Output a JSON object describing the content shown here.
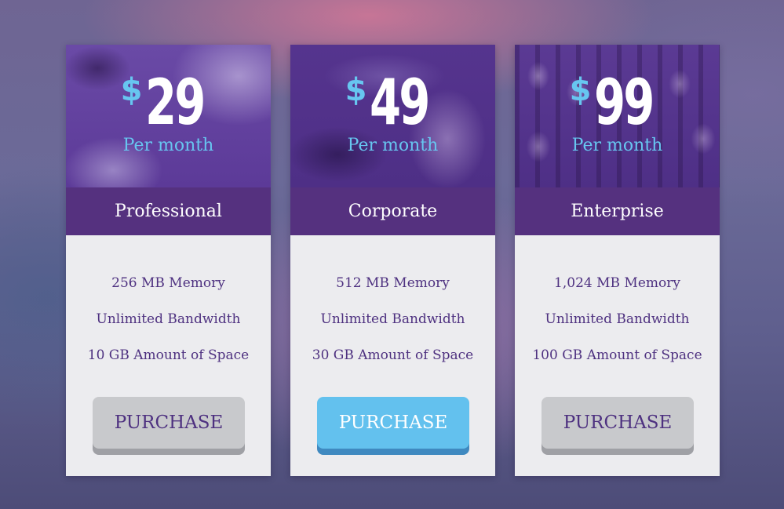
{
  "plans": [
    {
      "currency": "$",
      "amount": "29",
      "period": "Per month",
      "name": "Professional",
      "features": [
        "256 MB Memory",
        "Unlimited Bandwidth",
        "10 GB Amount of Space"
      ],
      "button_label": "PURCHASE",
      "highlighted": false
    },
    {
      "currency": "$",
      "amount": "49",
      "period": "Per month",
      "name": "Corporate",
      "features": [
        "512 MB Memory",
        "Unlimited Bandwidth",
        "30 GB Amount of Space"
      ],
      "button_label": "PURCHASE",
      "highlighted": true
    },
    {
      "currency": "$",
      "amount": "99",
      "period": "Per month",
      "name": "Enterprise",
      "features": [
        "1,024 MB Memory",
        "Unlimited Bandwidth",
        "100 GB Amount of Space"
      ],
      "button_label": "PURCHASE",
      "highlighted": false
    }
  ],
  "colors": {
    "plan_band": "#55317f",
    "accent_blue": "#67c6f0",
    "feature_text": "#4e3180",
    "button_default": "#c8c9cc",
    "button_primary": "#63c1ee"
  }
}
